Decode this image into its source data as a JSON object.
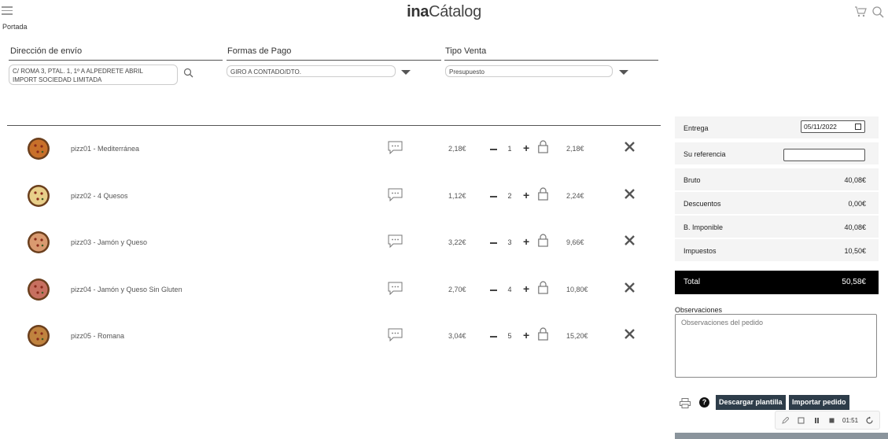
{
  "header": {
    "logo_bold": "ina",
    "logo_light": "Cátalog",
    "breadcrumb": "Portada"
  },
  "shipping": {
    "label": "Dirección de envío",
    "address_line1": "C/ ROMA 3, PTAL. 1, 1º A ALPEDRETE ABRIL",
    "address_line2": "IMPORT SOCIEDAD LIMITADA"
  },
  "payment": {
    "label": "Formas de Pago",
    "value": "GIRO A CONTADO/DTO."
  },
  "sale_type": {
    "label": "Tipo Venta",
    "value": "Presupuesto"
  },
  "items": [
    {
      "name": "pizz01 - Mediterránea",
      "price": "2,18€",
      "qty": "1",
      "total": "2,18€"
    },
    {
      "name": "pizz02 - 4 Quesos",
      "price": "1,12€",
      "qty": "2",
      "total": "2,24€"
    },
    {
      "name": "pizz03 - Jamón y Queso",
      "price": "3,22€",
      "qty": "3",
      "total": "9,66€"
    },
    {
      "name": "pizz04 - Jamón y Queso Sin Gluten",
      "price": "2,70€",
      "qty": "4",
      "total": "10,80€"
    },
    {
      "name": "pizz05 - Romana",
      "price": "3,04€",
      "qty": "5",
      "total": "15,20€"
    }
  ],
  "summary": {
    "entrega_label": "Entrega",
    "entrega_value": "05/11/2022",
    "referencia_label": "Su referencia",
    "bruto_label": "Bruto",
    "bruto_value": "40,08€",
    "descuentos_label": "Descuentos",
    "descuentos_value": "0,00€",
    "imponible_label": "B. Imponible",
    "imponible_value": "40,08€",
    "impuestos_label": "Impuestos",
    "impuestos_value": "10,50€",
    "total_label": "Total",
    "total_value": "50,58€"
  },
  "observations": {
    "label": "Observaciones",
    "placeholder": "Observaciones del pedido"
  },
  "actions": {
    "help": "?",
    "download_template": "Descargar plantilla",
    "import_order": "Importar pedido"
  },
  "recorder": {
    "time": "01:51"
  },
  "colors": {
    "button_bg": "#2e3d4a",
    "total_bg": "#000000",
    "summary_bg": "#f4f4f4"
  }
}
